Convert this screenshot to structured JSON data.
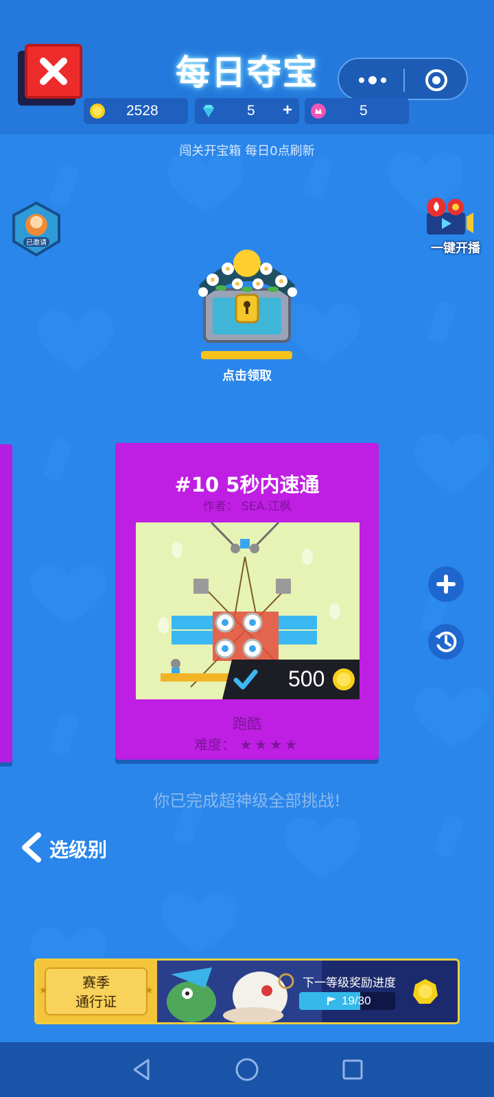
{
  "header": {
    "title": "每日夺宝"
  },
  "currencies": {
    "coins": "2528",
    "gems": "5",
    "gems_add": "+",
    "tickets": "5"
  },
  "subtitle": "闯关开宝箱 每日0点刷新",
  "badges": {
    "right_label": "一键开播",
    "left_label": "已邀请"
  },
  "chest": {
    "label": "点击领取"
  },
  "level_card": {
    "title": "#10 5秒内速通",
    "author": "作者：  SEA.江枫",
    "reward": "500",
    "category": "跑酷",
    "difficulty_label": "难度：",
    "difficulty_stars": "★★★★"
  },
  "completion_message": "你已完成超神级全部挑战!",
  "back_button": {
    "label": "选级别"
  },
  "season_banner": {
    "pass_line1": "赛季",
    "pass_line2": "通行证",
    "progress_title": "下一等级奖励进度",
    "progress_text": "19/30",
    "progress_value": 0.633
  },
  "colors": {
    "background": "#2a86ea",
    "card": "#bf1fe3",
    "accent_gold": "#f5c11b",
    "close_red": "#ee2b2b"
  }
}
